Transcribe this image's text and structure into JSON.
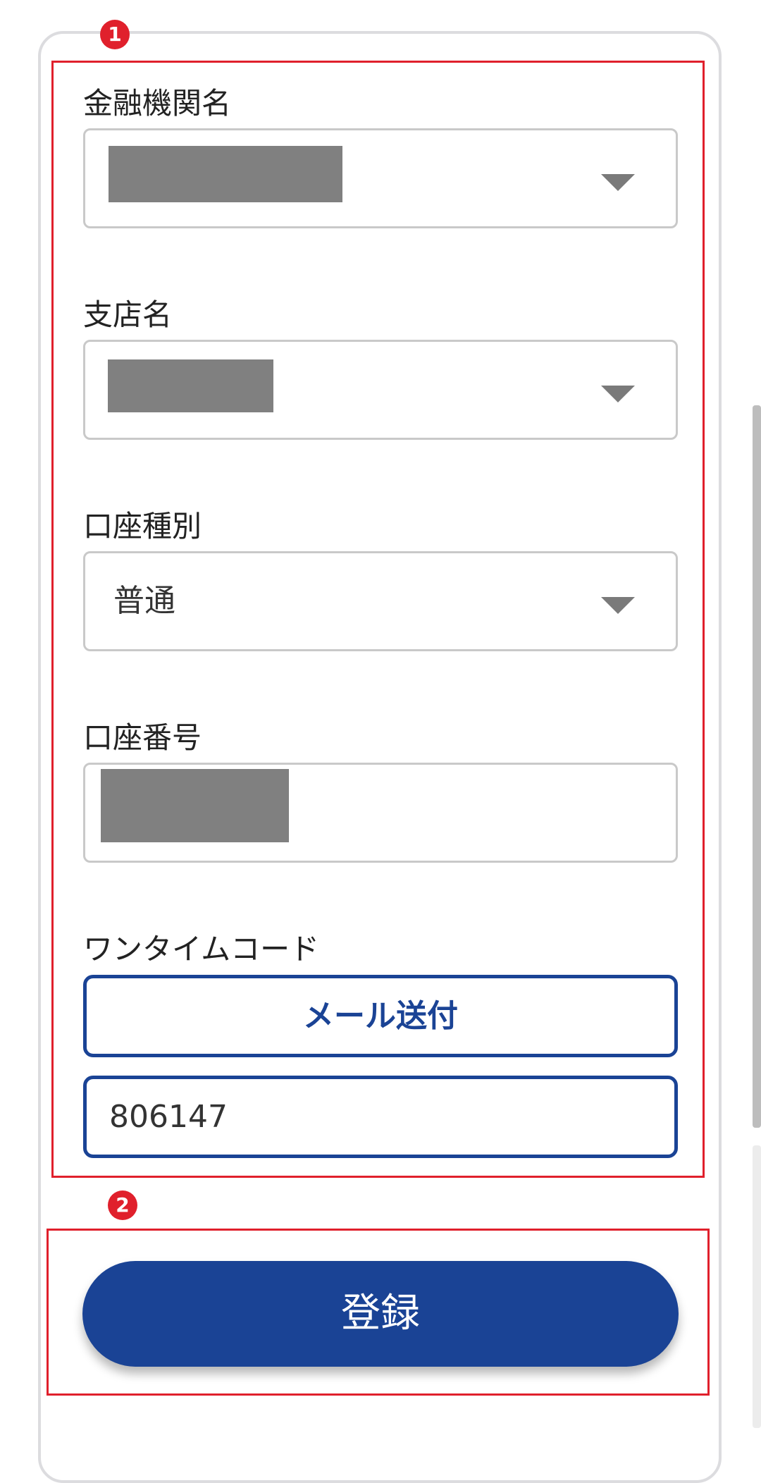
{
  "form": {
    "bank_name_label": "金融機関名",
    "branch_name_label": "支店名",
    "account_type_label": "口座種別",
    "account_type_value": "普通",
    "account_number_label": "口座番号",
    "onetime_code_label": "ワンタイムコード",
    "mail_send_label": "メール送付",
    "onetime_code_value": "806147",
    "submit_label": "登録"
  },
  "annotations": {
    "marker_1": "1",
    "marker_2": "2"
  },
  "icons": {
    "dropdown": "chevron-down-icon"
  },
  "colors": {
    "primary": "#1a4395",
    "annotation": "#e0202c",
    "border": "#c9c9c9",
    "redaction": "#808080"
  }
}
